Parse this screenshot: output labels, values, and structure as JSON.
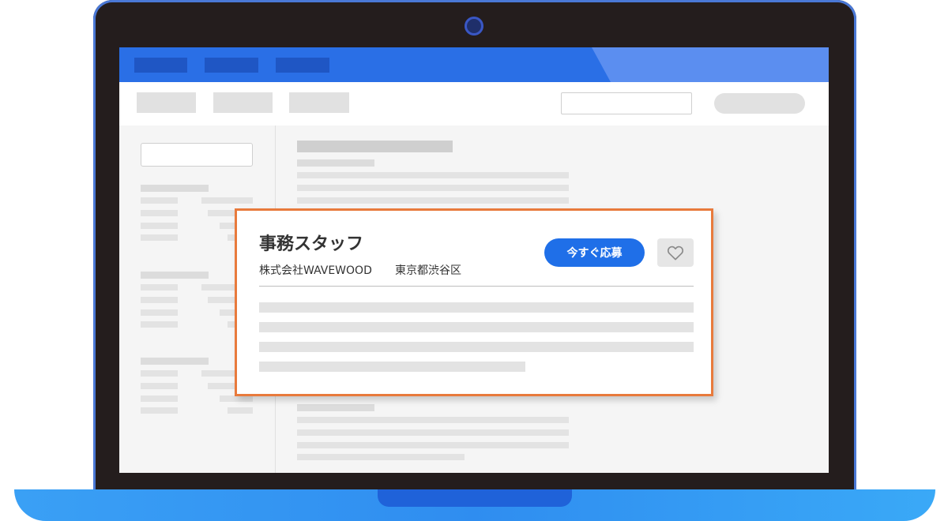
{
  "job_card": {
    "title": "事務スタッフ",
    "company": "株式会社WAVEWOOD",
    "location": "東京都渋谷区",
    "apply_label": "今すぐ応募",
    "favorite_icon": "heart-icon"
  },
  "colors": {
    "topbar": "#2a6fe6",
    "accent_border": "#e87a3c",
    "apply_button": "#1f6fe8",
    "laptop_base": "#2f8df0"
  }
}
